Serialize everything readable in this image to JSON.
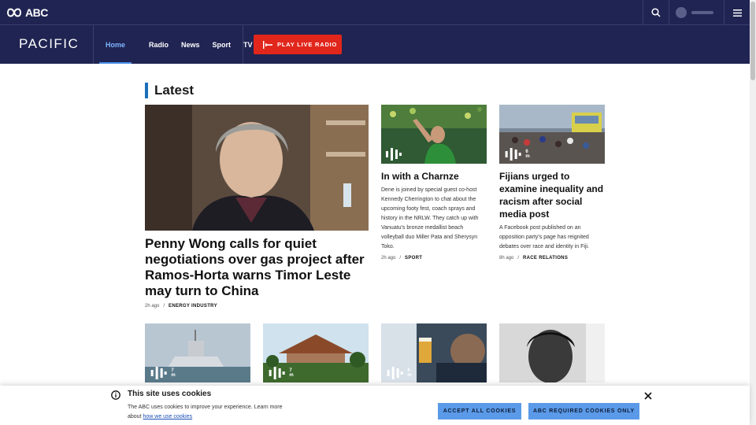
{
  "topbar": {
    "logo_text": "ABC",
    "search_icon": "search-icon",
    "menu_icon": "hamburger-menu-icon"
  },
  "nav": {
    "brand": "PACIFIC",
    "items": [
      {
        "label": "Home",
        "active": true
      },
      {
        "label": "Radio",
        "active": false
      },
      {
        "label": "News",
        "active": false
      },
      {
        "label": "Sport",
        "active": false
      },
      {
        "label": "TV",
        "active": false
      }
    ],
    "live_button": "PLAY LIVE RADIO"
  },
  "section": {
    "title": "Latest"
  },
  "featured": {
    "headline": "Penny Wong calls for quiet negotiations over gas project after Ramos-Horta warns Timor Leste may turn to China",
    "time": "2h ago",
    "sep": "/",
    "category": "ENERGY INDUSTRY"
  },
  "card1": {
    "headline": "In with a Charnze",
    "description": "Dene is joined by special guest co-host Kennedy Cherrington to chat about the upcoming footy fest, coach sprays and history in the NRLW. They catch up with Vanuatu's bronze medallist beach volleyball duo Miller Pata and Sherysyn Toko.",
    "time": "2h ago",
    "sep": "/",
    "category": "SPORT"
  },
  "card2": {
    "headline": "Fijians urged to examine inequality and racism after social media post",
    "description": "A Facebook post published on an opposition party's page has reignited debates over race and identity in Fiji.",
    "time": "8h ago",
    "sep": "/",
    "category": "RACE RELATIONS",
    "audio_duration": "6 m"
  },
  "row2": [
    {
      "audio_duration": "7 m"
    },
    {
      "audio_duration": "7 m"
    },
    {
      "audio_duration": "6 m"
    }
  ],
  "cookie": {
    "title": "This site uses cookies",
    "text": "The ABC uses cookies to improve your experience. Learn more about",
    "link": "how we use cookies",
    "accept_all": "ACCEPT ALL COOKIES",
    "required_only": "ABC REQUIRED COOKIES ONLY"
  },
  "colors": {
    "nav_bg": "#202452",
    "live_red": "#e1261c",
    "accent_blue": "#1a6fb8",
    "cookie_btn": "#5b9ae8"
  }
}
